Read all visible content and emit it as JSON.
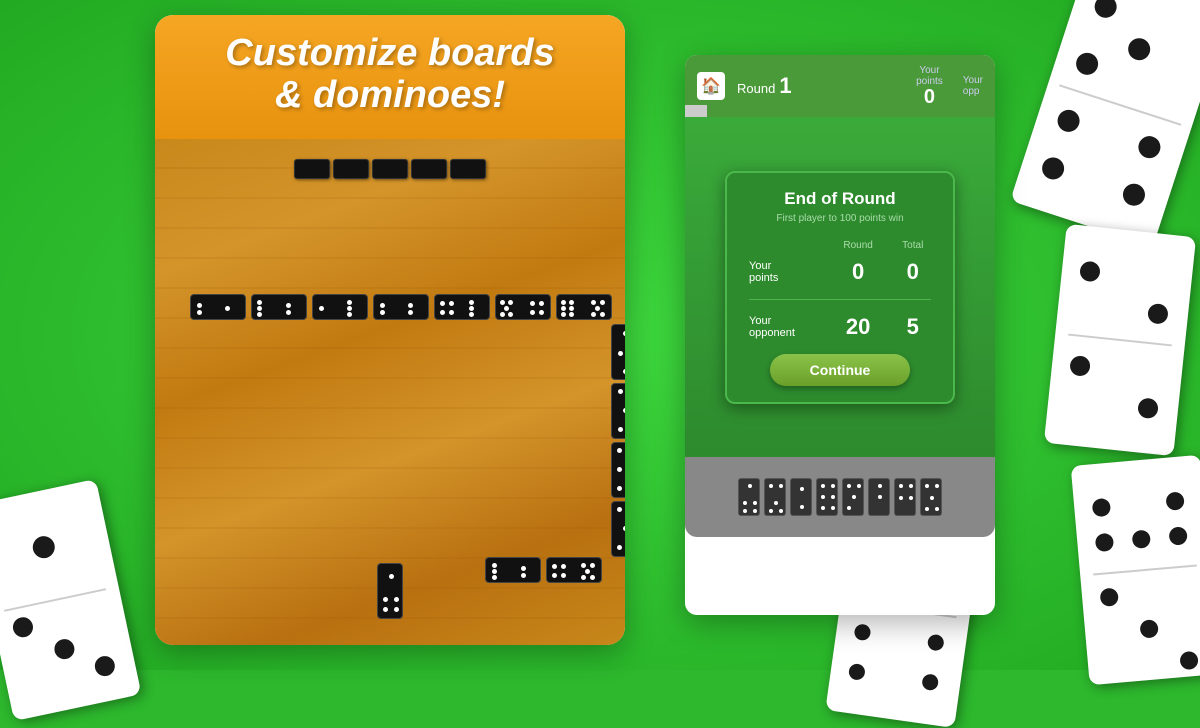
{
  "background": {
    "color": "#2db82d"
  },
  "left_panel": {
    "header": {
      "line1": "Customize boards",
      "line2": "& dominoes!"
    }
  },
  "right_panel": {
    "header": {
      "round_label": "Round",
      "round_value": "1",
      "your_points_label": "Your\npoints",
      "your_points_value": "0",
      "your_opp_label": "Your\nopp"
    },
    "dialog": {
      "title": "End of Round",
      "subtitle": "First player to 100 points win",
      "your_points_label": "Your\npoints",
      "round_header": "Round",
      "total_header": "Total",
      "player_round": "0",
      "player_total": "0",
      "opponent_label": "Your\nopponent",
      "opponent_round": "20",
      "opponent_total": "5",
      "continue_label": "Continue"
    }
  }
}
